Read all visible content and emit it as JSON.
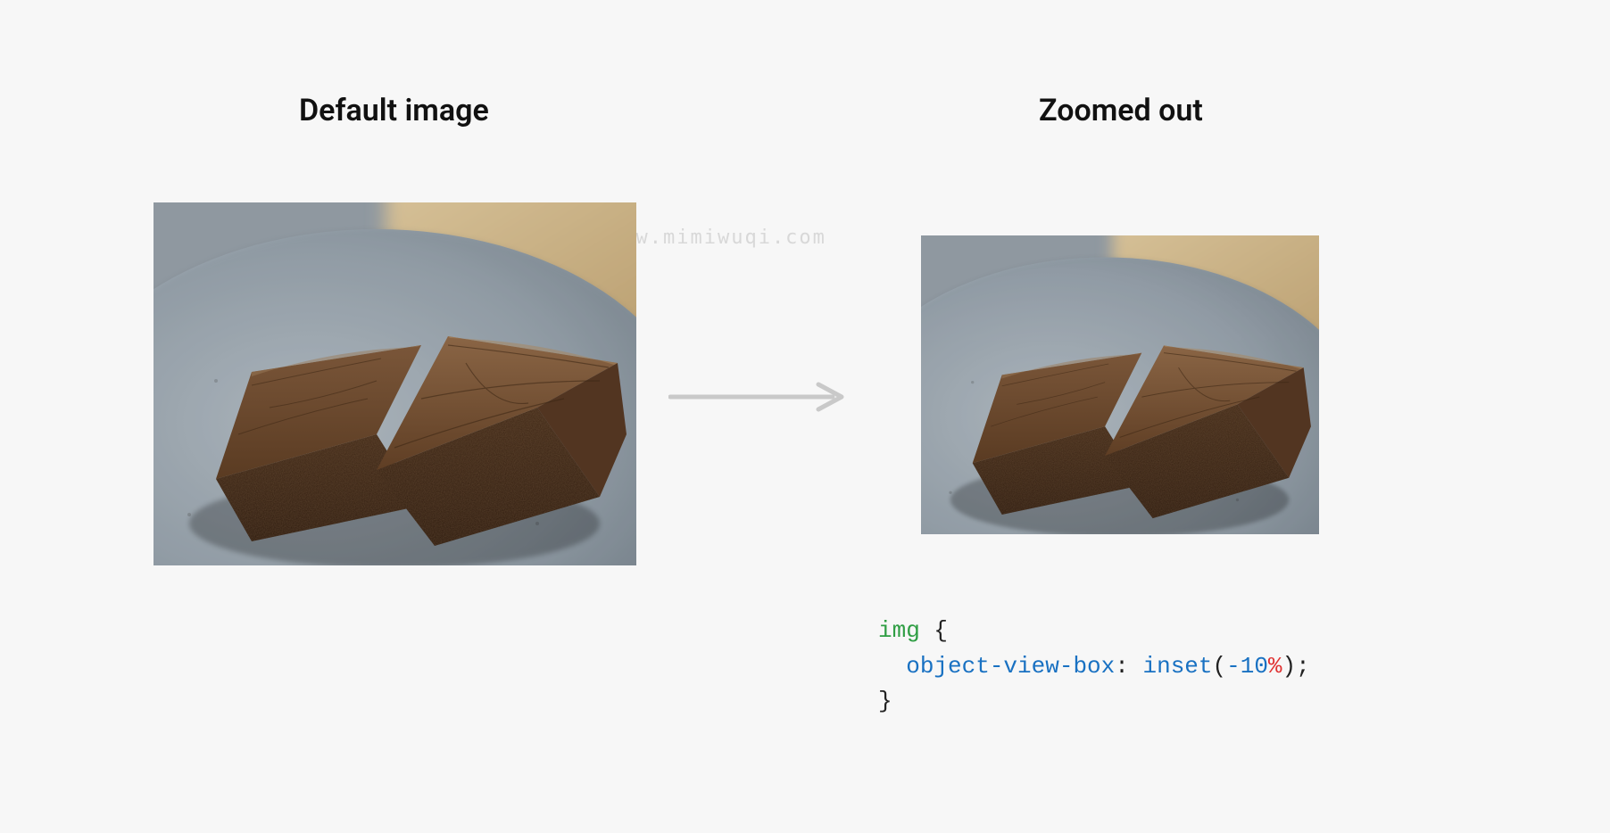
{
  "headings": {
    "left": "Default image",
    "right": "Zoomed out"
  },
  "watermark": "www.mimiwuqi.com",
  "code": {
    "selector": "img",
    "brace_open": "{",
    "property": "object-view-box",
    "colon": ": ",
    "fn": "inset",
    "paren_open": "(",
    "value_number": "-10",
    "value_unit": "%",
    "paren_close": ")",
    "semicolon": ";",
    "brace_close": "}"
  },
  "image": {
    "alt": "Two chocolate brownies on a grey ceramic plate"
  }
}
